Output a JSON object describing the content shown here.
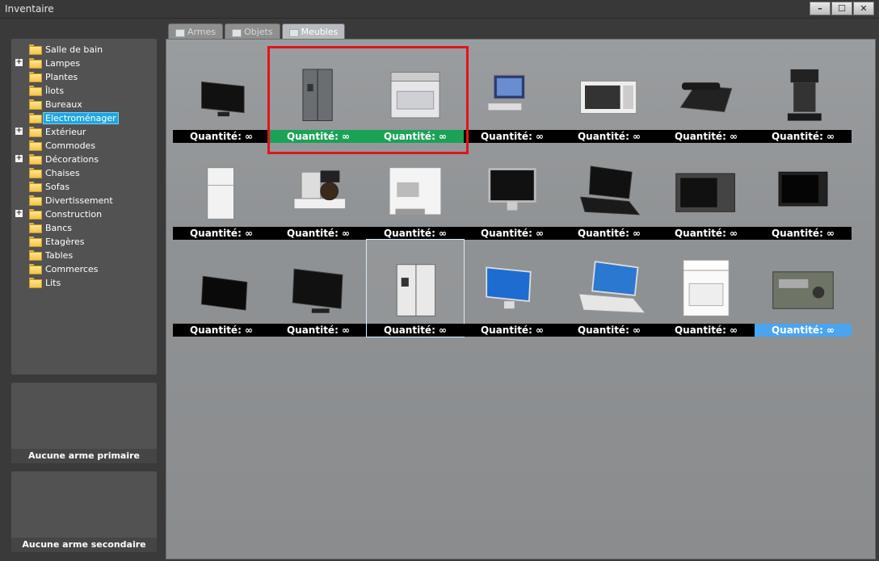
{
  "window": {
    "title": "Inventaire",
    "minimize": "–",
    "maximize": "☐",
    "close": "✕"
  },
  "tabs": [
    {
      "label": "Armes",
      "active": false
    },
    {
      "label": "Objets",
      "active": false
    },
    {
      "label": "Meubles",
      "active": true
    }
  ],
  "categories": [
    {
      "label": "Salle de bain",
      "expandable": false
    },
    {
      "label": "Lampes",
      "expandable": true
    },
    {
      "label": "Plantes",
      "expandable": false
    },
    {
      "label": "Îlots",
      "expandable": false
    },
    {
      "label": "Bureaux",
      "expandable": false
    },
    {
      "label": "Electroménager",
      "expandable": false,
      "selected": true
    },
    {
      "label": "Extérieur",
      "expandable": true
    },
    {
      "label": "Commodes",
      "expandable": false
    },
    {
      "label": "Décorations",
      "expandable": true
    },
    {
      "label": "Chaises",
      "expandable": false
    },
    {
      "label": "Sofas",
      "expandable": false
    },
    {
      "label": "Divertissement",
      "expandable": false
    },
    {
      "label": "Construction",
      "expandable": true
    },
    {
      "label": "Bancs",
      "expandable": false
    },
    {
      "label": "Etagères",
      "expandable": false
    },
    {
      "label": "Tables",
      "expandable": false
    },
    {
      "label": "Commerces",
      "expandable": false
    },
    {
      "label": "Lits",
      "expandable": false
    }
  ],
  "slots": {
    "primary": "Aucune arme primaire",
    "secondary": "Aucune arme secondaire"
  },
  "quantity_label": "Quantité: ∞",
  "items": [
    {
      "name": "flat-tv",
      "state": "normal"
    },
    {
      "name": "steel-fridge",
      "state": "green"
    },
    {
      "name": "electric-stove",
      "state": "green"
    },
    {
      "name": "desktop-computer",
      "state": "normal"
    },
    {
      "name": "microwave",
      "state": "normal"
    },
    {
      "name": "desk-phone",
      "state": "normal"
    },
    {
      "name": "coffee-maker",
      "state": "normal"
    },
    {
      "name": "white-fridge",
      "state": "normal"
    },
    {
      "name": "drip-coffee-machine",
      "state": "normal"
    },
    {
      "name": "espresso-machine",
      "state": "normal"
    },
    {
      "name": "imac",
      "state": "normal"
    },
    {
      "name": "black-laptop",
      "state": "normal"
    },
    {
      "name": "dark-microwave",
      "state": "normal"
    },
    {
      "name": "crt-tv",
      "state": "normal"
    },
    {
      "name": "wall-tv",
      "state": "normal"
    },
    {
      "name": "lcd-tv",
      "state": "normal"
    },
    {
      "name": "double-fridge",
      "state": "selected"
    },
    {
      "name": "blue-monitor",
      "state": "normal"
    },
    {
      "name": "macbook",
      "state": "normal"
    },
    {
      "name": "white-stove",
      "state": "normal"
    },
    {
      "name": "radio",
      "state": "blue"
    }
  ]
}
